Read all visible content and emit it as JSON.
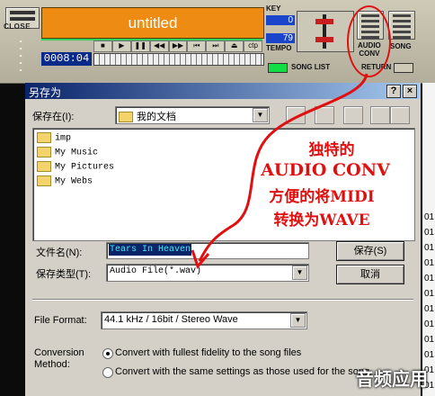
{
  "player": {
    "close_label": "CLOSE",
    "song_title": "untitled",
    "time": "0008:04",
    "key_label": "KEY",
    "key_value": "0",
    "tempo_label": "TEMPO",
    "tempo_value": "79",
    "song_list_label": "SONG LIST",
    "audio_conv_label": "AUDIO\nCONV",
    "song_label": "SONG",
    "return_label": "RETURN",
    "controls": [
      "■",
      "▶",
      "❚❚",
      "◀◀",
      "▶▶",
      "⏮",
      "⏭",
      "⏏",
      "ctp"
    ]
  },
  "dialog": {
    "title": "另存为",
    "help_btn": "?",
    "close_btn": "×",
    "save_in_label": "保存在(I):",
    "save_in_value": "我的文档",
    "folders": [
      "imp",
      "My Music",
      "My Pictures",
      "My Webs"
    ],
    "filename_label": "文件名(N):",
    "filename_value": "Tears In Heaven",
    "filetype_label": "保存类型(T):",
    "filetype_value": "Audio File(*.wav)",
    "save_button": "保存(S)",
    "cancel_button": "取消",
    "file_format_label": "File Format:",
    "file_format_value": "44.1  kHz / 16bit / Stereo Wave",
    "conversion_label": "Conversion\nMethod:",
    "radio_1": "Convert with fullest fidelity to the song files",
    "radio_2": "Convert with the same settings as those used for the song"
  },
  "background_rows": [
    "01",
    "01",
    "01",
    "01",
    "01",
    "01",
    "01",
    "01",
    "01",
    "01",
    "01",
    "01"
  ],
  "annotation": {
    "line1": "独特的",
    "line2": "AUDIO CONV",
    "line3": "方便的将MIDI",
    "line4": "转换为WAVE"
  },
  "watermark": "音频应用",
  "colors": {
    "display": "#ee8b12",
    "titlebar": "#0a246a",
    "annotation": "#e01010",
    "tempo_box": "#1a44c9"
  }
}
